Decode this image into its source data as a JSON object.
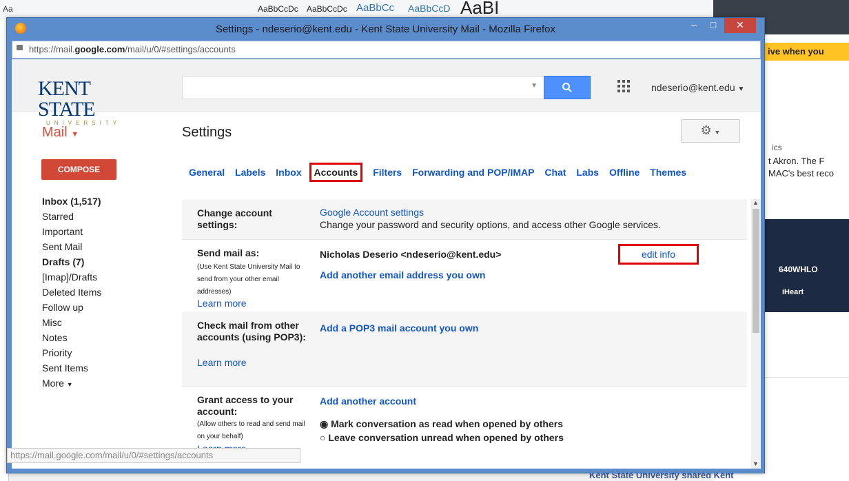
{
  "background": {
    "ribbon_items": [
      "Aa",
      "AaBbCcDc",
      "AaBbCcDc",
      "AaBbCc",
      "AaBbCcD",
      "AaBI"
    ],
    "right_banner": "ive when you",
    "right_text_1": "ics",
    "right_text_2": "t Akron. The F",
    "right_text_3": "MAC's best reco",
    "ad_radio_1": "640WHLO",
    "ad_radio_2": "iHeart",
    "bottom_post": "Kent State University shared Kent"
  },
  "window": {
    "title": "Settings - ndeserio@kent.edu - Kent State University Mail - Mozilla Firefox",
    "url_prefix": "https://mail.",
    "url_domain": "google.com",
    "url_suffix": "/mail/u/0/#settings/accounts"
  },
  "header": {
    "logo_top": "KENT STATE",
    "logo_bottom": "UNIVERSITY",
    "account": "ndeserio@kent.edu"
  },
  "sidebar": {
    "mail_label": "Mail",
    "compose": "COMPOSE",
    "items": [
      "Inbox (1,517)",
      "Starred",
      "Important",
      "Sent Mail",
      "Drafts (7)",
      "[Imap]/Drafts",
      "Deleted Items",
      "Follow up",
      "Misc",
      "Notes",
      "Priority",
      "Sent Items",
      "More"
    ]
  },
  "settings": {
    "title": "Settings",
    "tabs": [
      "General",
      "Labels",
      "Inbox",
      "Accounts",
      "Filters",
      "Forwarding and POP/IMAP",
      "Chat",
      "Labs",
      "Offline",
      "Themes"
    ],
    "rows": {
      "change_label": "Change account settings:",
      "change_link": "Google Account settings",
      "change_desc": "Change your password and security options, and access other Google services.",
      "send_label": "Send mail as:",
      "send_sub": "(Use Kent State University Mail to send from your other email addresses)",
      "send_learn": "Learn more",
      "send_address": "Nicholas Deserio <ndeserio@kent.edu>",
      "send_edit": "edit info",
      "send_add": "Add another email address you own",
      "check_label": "Check mail from other accounts (using POP3):",
      "check_learn": "Learn more",
      "check_add": "Add a POP3 mail account you own",
      "grant_label": "Grant access to your account:",
      "grant_sub": "(Allow others to read and send mail on your behalf)",
      "grant_learn": "Learn more",
      "grant_add": "Add another account",
      "grant_opt1": "Mark conversation as read when opened by others",
      "grant_opt2": "Leave conversation unread when opened by others"
    }
  },
  "status_url": "https://mail.google.com/mail/u/0/#settings/accounts",
  "colors": {
    "compose": "#d14836",
    "link": "#1155cc",
    "highlight": "#e00000",
    "search": "#4d90fe"
  }
}
